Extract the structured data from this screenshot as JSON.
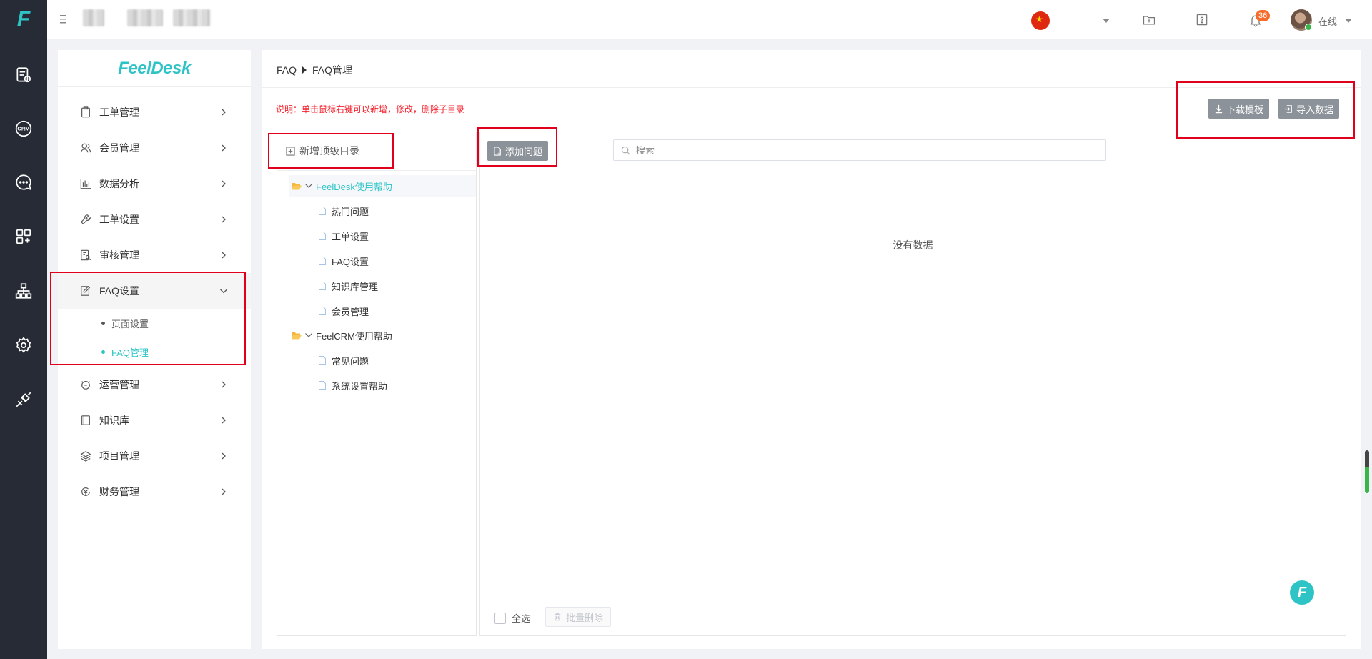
{
  "rail": {
    "logo": "F",
    "icons": [
      "ticket-settings-icon",
      "crm-icon",
      "chat-icon",
      "apps-icon",
      "org-chart-icon",
      "settings-icon",
      "plugin-icon"
    ],
    "crm_label": "CRM"
  },
  "topbar": {
    "notification_count": "36",
    "status": "在线",
    "icons": [
      "china-flag-icon",
      "folder-add-icon",
      "help-icon",
      "bell-icon"
    ]
  },
  "sidemenu": {
    "brand": "FeelDesk",
    "items": [
      {
        "label": "工单管理",
        "icon": "clipboard-icon"
      },
      {
        "label": "会员管理",
        "icon": "users-icon"
      },
      {
        "label": "数据分析",
        "icon": "bar-chart-icon"
      },
      {
        "label": "工单设置",
        "icon": "wrench-icon"
      },
      {
        "label": "审核管理",
        "icon": "audit-icon"
      },
      {
        "label": "FAQ设置",
        "icon": "faq-edit-icon"
      },
      {
        "label": "运营管理",
        "icon": "operation-icon"
      },
      {
        "label": "知识库",
        "icon": "book-icon"
      },
      {
        "label": "项目管理",
        "icon": "layers-icon"
      },
      {
        "label": "财务管理",
        "icon": "finance-icon"
      }
    ],
    "submenu": [
      {
        "label": "页面设置"
      },
      {
        "label": "FAQ管理"
      }
    ]
  },
  "main": {
    "breadcrumb": [
      "FAQ",
      "FAQ管理"
    ],
    "note": "说明：单击鼠标右键可以新增，修改，删除子目录",
    "download_template": "下载模板",
    "import_data": "导入数据",
    "add_top_dir": "新增顶级目录",
    "add_question": "添加问题",
    "search_placeholder": "搜索",
    "empty_text": "没有数据",
    "select_all": "全选",
    "batch_delete": "批量删除",
    "tree": [
      {
        "label": "FeelDesk使用帮助",
        "children": [
          "热门问题",
          "工单设置",
          "FAQ设置",
          "知识库管理",
          "会员管理"
        ]
      },
      {
        "label": "FeelCRM使用帮助",
        "children": [
          "常见问题",
          "系统设置帮助"
        ]
      }
    ]
  },
  "colors": {
    "accent": "#2ec4c6",
    "rail_bg": "#262b36",
    "highlight": "#e0001b",
    "note": "#f5222d",
    "badge": "#f56c2d"
  }
}
